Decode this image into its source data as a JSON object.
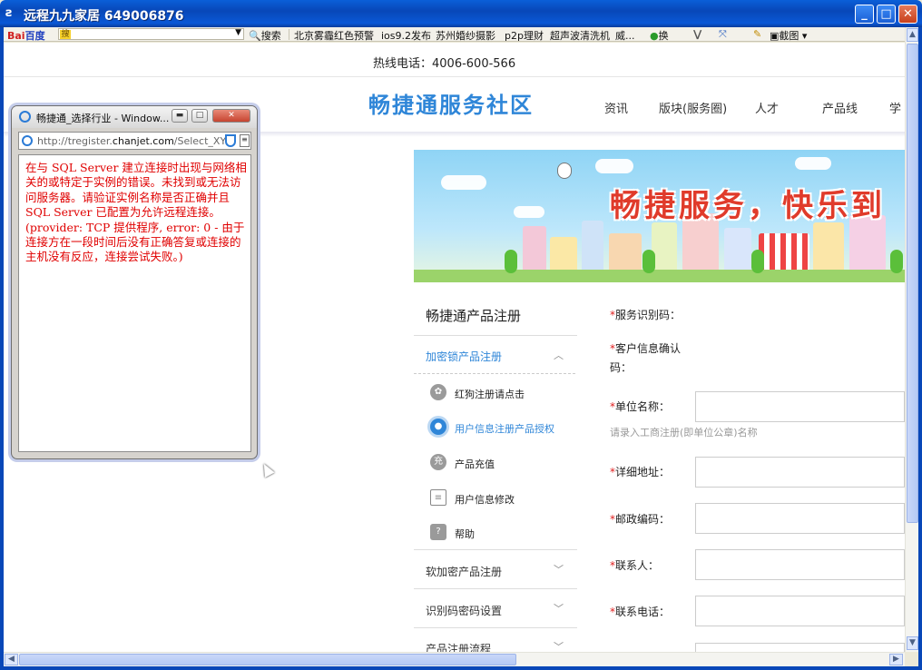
{
  "window": {
    "title": "远程九九家居  649006876",
    "buttons": {
      "minimize": "_",
      "maximize": "□",
      "close": "✕"
    }
  },
  "toolbar": {
    "baidu_part1": "Bai",
    "baidu_part2": "百度",
    "search_highlight": "搜",
    "search_label": "搜索",
    "hot_items": [
      "北京雾霾红色预警",
      "ios9.2发布",
      "苏州婚纱摄影",
      "p2p理财",
      "超声波清洗机",
      "威..."
    ],
    "translate_label": "换",
    "screenshot_label": "截图"
  },
  "site": {
    "hotline": "热线电话：4006-600-566",
    "title": "畅捷通服务社区",
    "nav": [
      "资讯",
      "版块(服务圈)",
      "人才",
      "产品线",
      "学"
    ]
  },
  "banner": {
    "slogan": "畅捷服务，快乐到"
  },
  "register_menu": {
    "title": "畅捷通产品注册",
    "sections": [
      {
        "label": "加密锁产品注册",
        "expanded": true,
        "items": [
          {
            "label": "红狗注册请点击",
            "icon": "badge-icon"
          },
          {
            "label": "用户信息注册产品授权",
            "icon": "user-auth-icon",
            "active": true
          },
          {
            "label": "产品充值",
            "icon": "charge-icon"
          },
          {
            "label": "用户信息修改",
            "icon": "edit-doc-icon"
          },
          {
            "label": "帮助",
            "icon": "help-icon"
          }
        ]
      },
      {
        "label": "软加密产品注册",
        "expanded": false
      },
      {
        "label": "识别码密码设置",
        "expanded": false
      },
      {
        "label": "产品注册流程",
        "expanded": false
      }
    ]
  },
  "form": {
    "service_code_label": "服务识别码：",
    "customer_code_label_1": "客户信息确认",
    "customer_code_label_2": "码：",
    "company_label": "单位名称：",
    "company_hint": "请录入工商注册(即单位公章)名称",
    "address_label": "详细地址：",
    "postcode_label": "邮政编码：",
    "contact_label": "联系人：",
    "phone_label": "联系电话：",
    "required_mark": "*"
  },
  "popup": {
    "title": "畅捷通_选择行业 - Window...",
    "url_prefix": "http://tregister.",
    "url_domain": "chanjet.com",
    "url_suffix": "/Select_XY",
    "error_text": "在与 SQL Server 建立连接时出现与网络相关的或特定于实例的错误。未找到或无法访问服务器。请验证实例名称是否正确并且 SQL Server 已配置为允许远程连接。 (provider: TCP 提供程序, error: 0 - 由于连接方在一段时间后没有正确答复或连接的主机没有反应，连接尝试失败。)"
  },
  "colors": {
    "brand_blue": "#2f86d8",
    "error_red": "#e00000",
    "slogan_red": "#e03b2b",
    "titlebar_blue": "#0847b8"
  }
}
